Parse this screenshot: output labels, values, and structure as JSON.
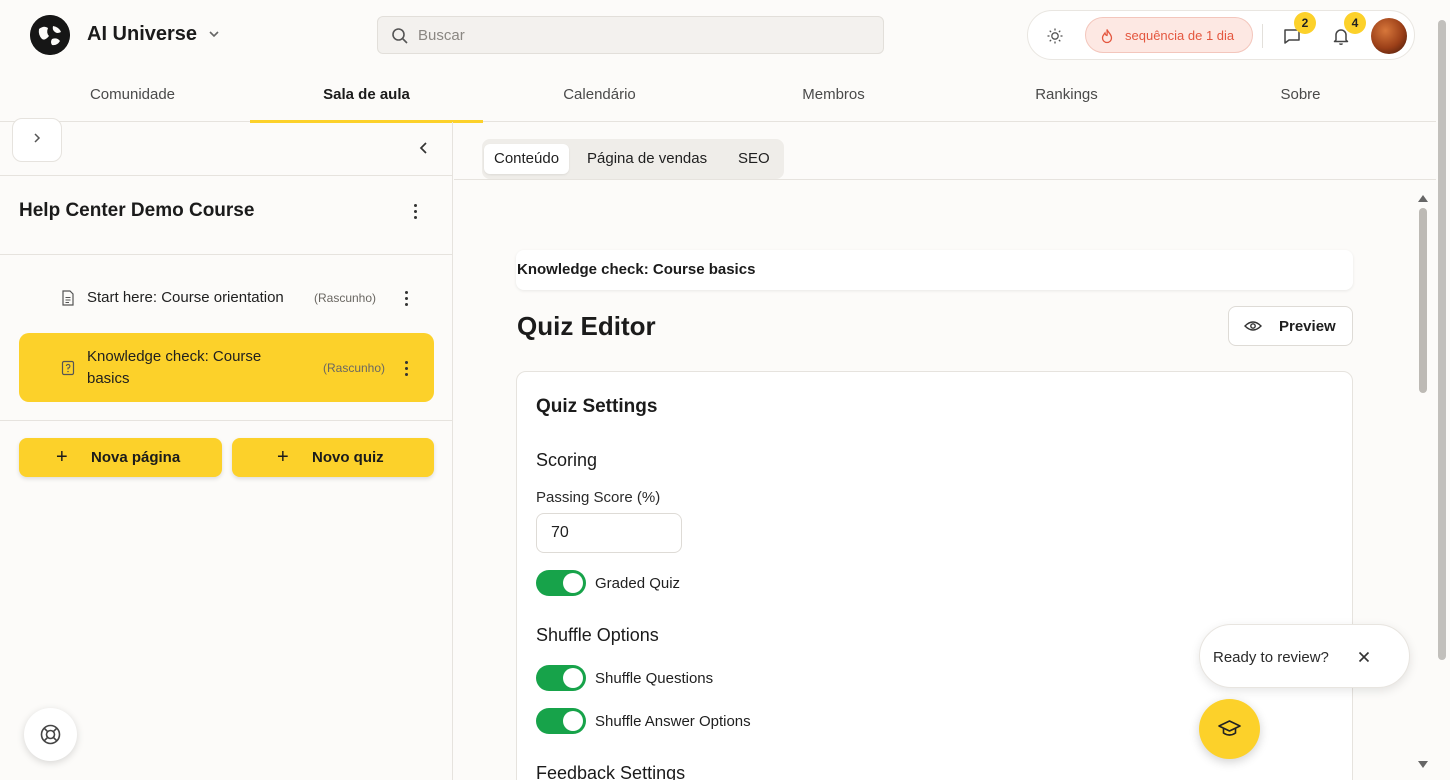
{
  "header": {
    "app_title": "AI Universe",
    "search_placeholder": "Buscar",
    "streak_label": "sequência de 1 dia",
    "chat_badge": "2",
    "notification_badge": "4"
  },
  "nav": {
    "tabs": [
      {
        "label": "Comunidade"
      },
      {
        "label": "Sala de aula"
      },
      {
        "label": "Calendário"
      },
      {
        "label": "Membros"
      },
      {
        "label": "Rankings"
      },
      {
        "label": "Sobre"
      }
    ],
    "active": "Sala de aula"
  },
  "sidebar": {
    "course_title": "Help Center Demo Course",
    "lessons": [
      {
        "title": "Start here: Course orientation",
        "status": "(Rascunho)"
      },
      {
        "title": "Knowledge check: Course basics",
        "status": "(Rascunho)"
      }
    ],
    "new_page_label": "Nova página",
    "new_quiz_label": "Novo quiz"
  },
  "main": {
    "subtabs": [
      {
        "label": "Conteúdo"
      },
      {
        "label": "Página de vendas"
      },
      {
        "label": "SEO"
      }
    ],
    "breadcrumb": "Knowledge check: Course basics",
    "title": "Quiz Editor",
    "preview_label": "Preview",
    "settings": {
      "heading": "Quiz Settings",
      "scoring_heading": "Scoring",
      "passing_score_label": "Passing Score (%)",
      "passing_score_value": "70",
      "graded_quiz_label": "Graded Quiz",
      "graded_quiz_on": true,
      "shuffle_heading": "Shuffle Options",
      "shuffle_questions_label": "Shuffle Questions",
      "shuffle_questions_on": true,
      "shuffle_answers_label": "Shuffle Answer Options",
      "shuffle_answers_on": true,
      "feedback_heading": "Feedback Settings"
    }
  },
  "review_popup": {
    "text": "Ready to review?"
  },
  "colors": {
    "accent": "#fcd12a",
    "toggle_on": "#17a34a",
    "streak_text": "#e4573f"
  },
  "icons": [
    "logo-icon",
    "chevron-down-icon",
    "search-icon",
    "sun-icon",
    "flame-icon",
    "chat-icon",
    "bell-icon",
    "chevron-right-icon",
    "chevron-left-icon",
    "document-icon",
    "quiz-icon",
    "kebab-icon",
    "plus-icon",
    "eye-icon",
    "lifebuoy-icon",
    "close-icon",
    "graduation-cap-icon"
  ]
}
